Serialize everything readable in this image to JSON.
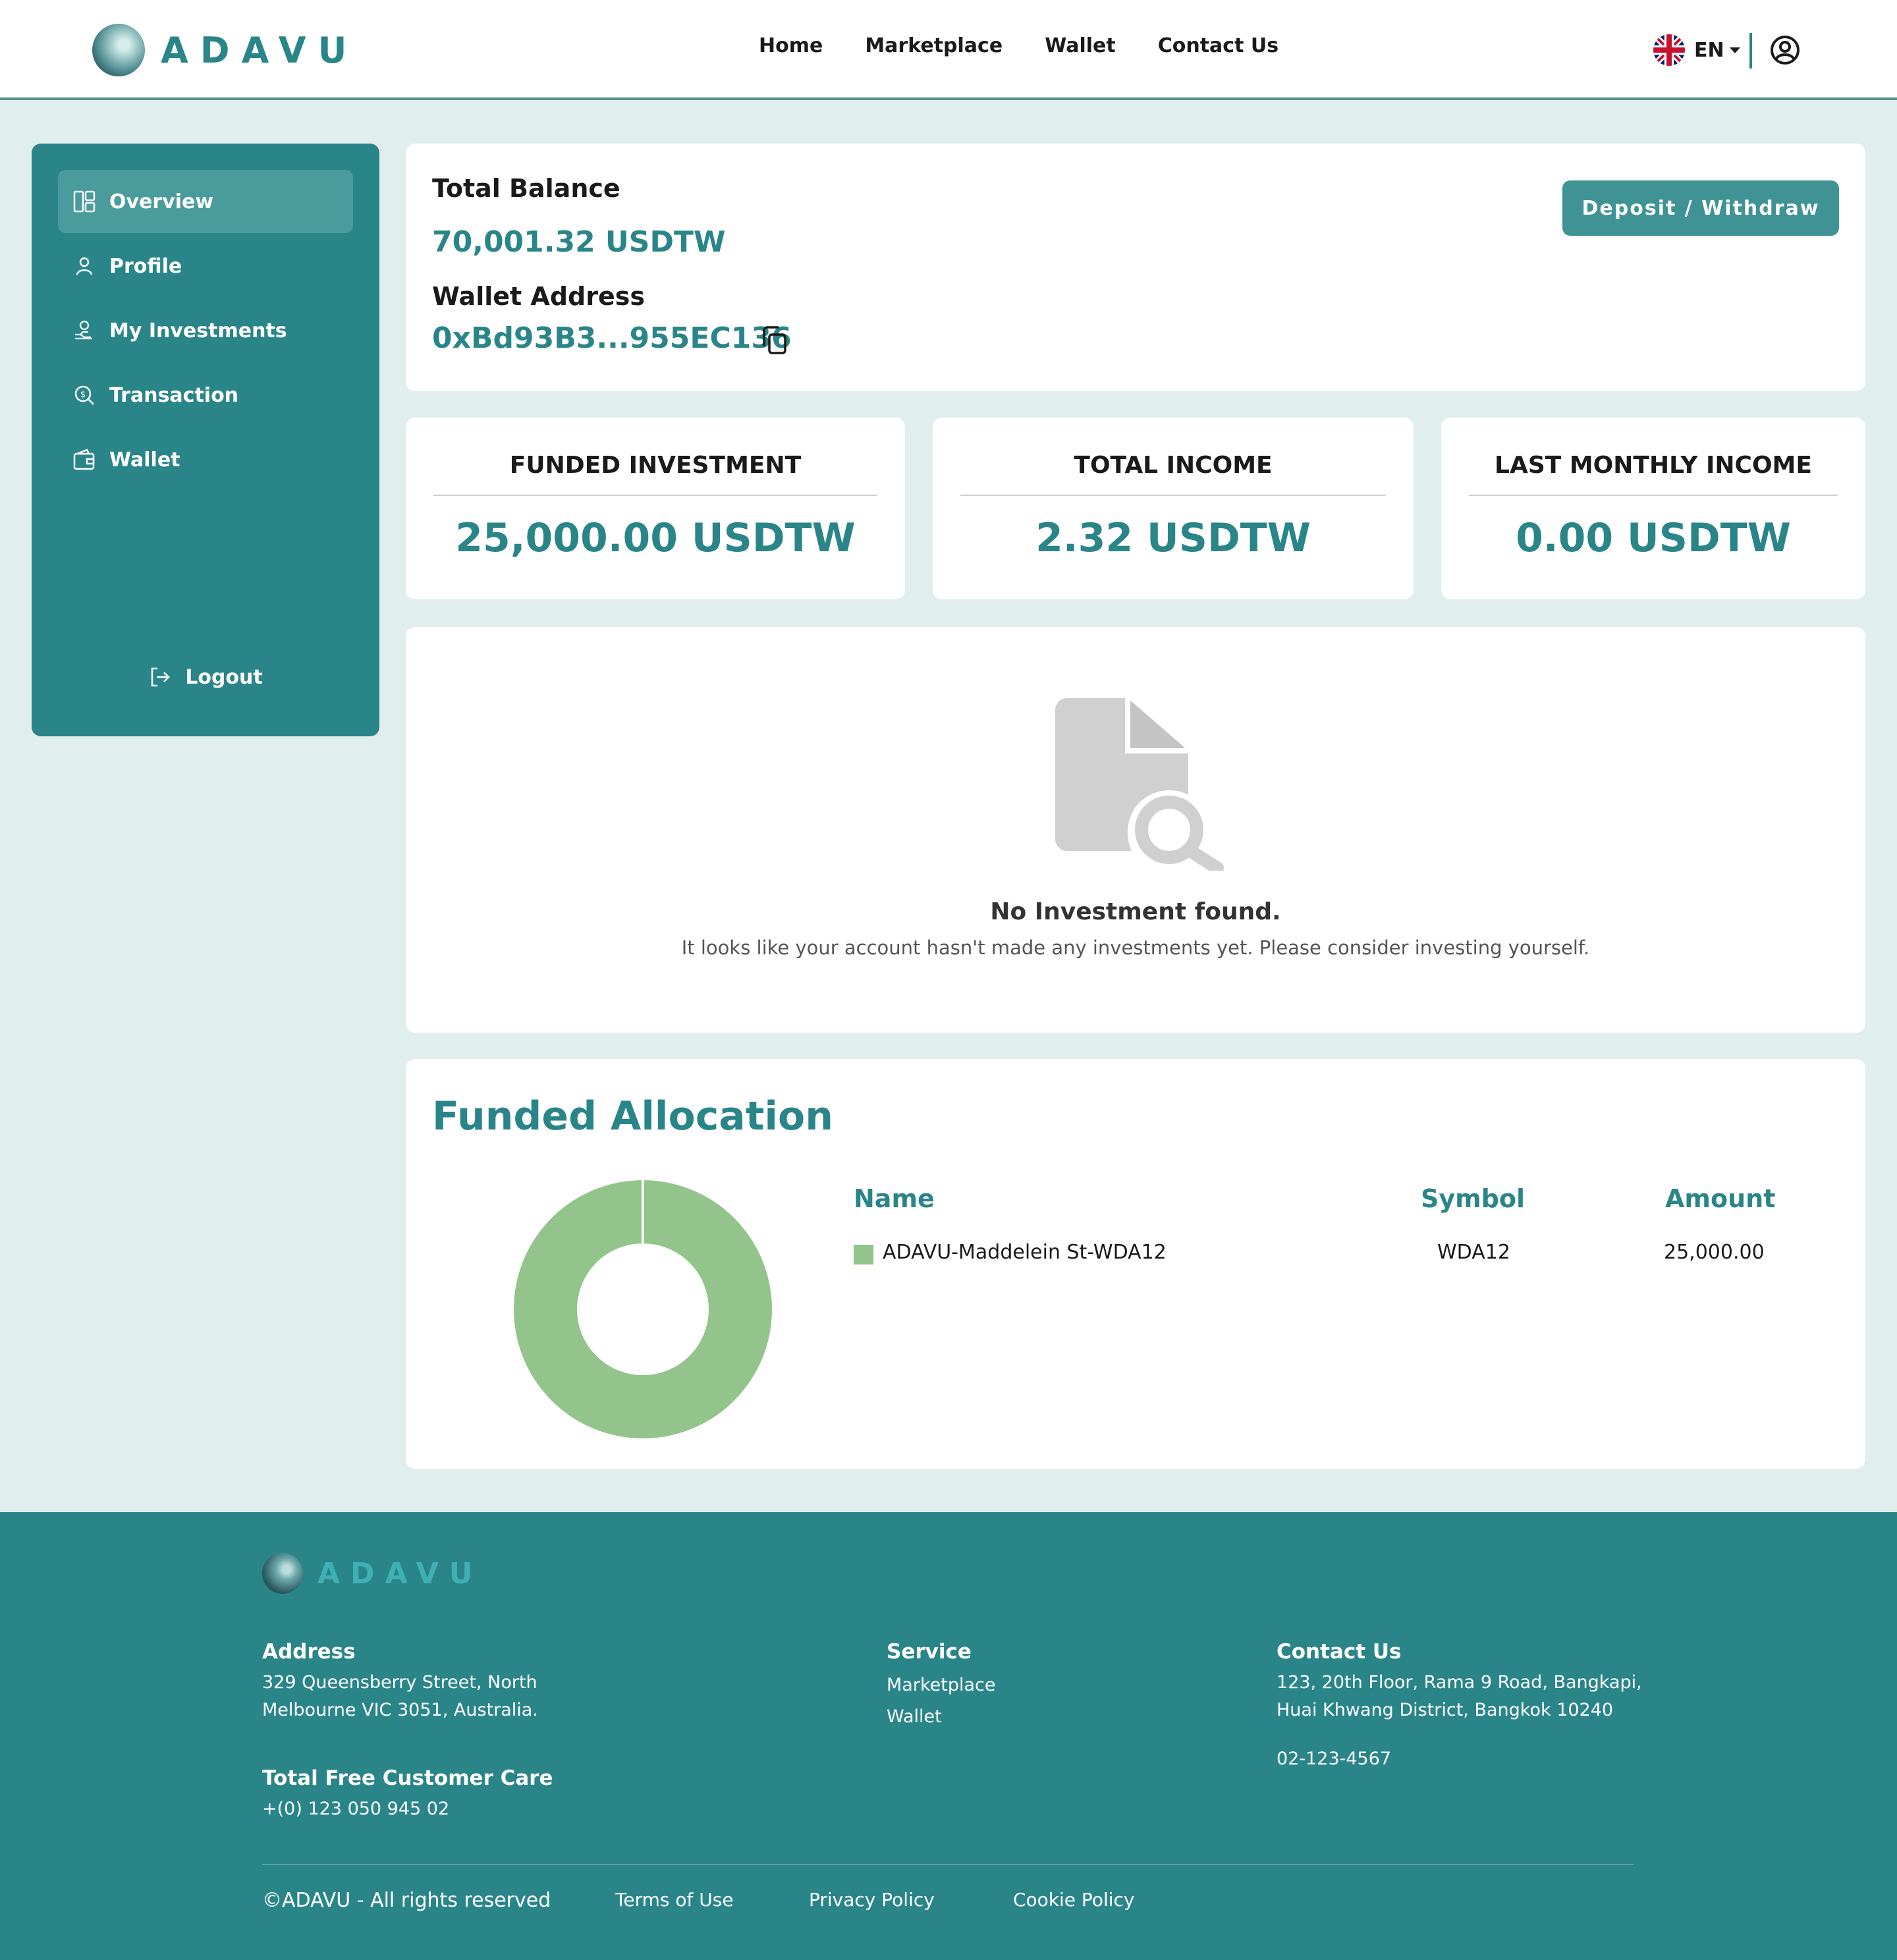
{
  "brand": {
    "name": "ADAVU"
  },
  "nav": {
    "items": [
      {
        "label": "Home"
      },
      {
        "label": "Marketplace"
      },
      {
        "label": "Wallet"
      },
      {
        "label": "Contact Us"
      }
    ],
    "language": "EN"
  },
  "sidebar": {
    "items": [
      {
        "label": "Overview",
        "icon": "layout-icon",
        "active": true
      },
      {
        "label": "Profile",
        "icon": "person-icon"
      },
      {
        "label": "My Investments",
        "icon": "investment-icon"
      },
      {
        "label": "Transaction",
        "icon": "transaction-icon"
      },
      {
        "label": "Wallet",
        "icon": "wallet-icon"
      }
    ],
    "logout_label": "Logout"
  },
  "balance": {
    "title": "Total Balance",
    "value": "70,001.32 USDTW",
    "wallet_title": "Wallet Address",
    "wallet_address": "0xBd93B3...955EC136",
    "button_label": "Deposit / Withdraw"
  },
  "stats": [
    {
      "title": "FUNDED INVESTMENT",
      "value": "25,000.00 USDTW"
    },
    {
      "title": "TOTAL INCOME",
      "value": "2.32 USDTW"
    },
    {
      "title": "LAST MONTHLY INCOME",
      "value": "0.00 USDTW"
    }
  ],
  "empty_state": {
    "title": "No Investment found.",
    "text": "It looks like your account hasn't made any investments yet. Please consider investing yourself."
  },
  "allocation": {
    "title": "Funded Allocation",
    "headers": {
      "name": "Name",
      "symbol": "Symbol",
      "amount": "Amount"
    },
    "rows": [
      {
        "name": "ADAVU-Maddelein St-WDA12",
        "symbol": "WDA12",
        "amount": "25,000.00",
        "color": "#93c48b"
      }
    ]
  },
  "chart_data": {
    "type": "pie",
    "categories": [
      "ADAVU-Maddelein St-WDA12"
    ],
    "values": [
      25000.0
    ],
    "colors": [
      "#93c48b"
    ]
  },
  "footer": {
    "address_title": "Address",
    "address_line1": "329 Queensberry Street, North",
    "address_line2": "Melbourne VIC 3051, Australia.",
    "care_title": "Total Free Customer Care",
    "care_phone": "+(0) 123 050 945 02",
    "service_title": "Service",
    "service_links": [
      "Marketplace",
      "Wallet"
    ],
    "contact_title": "Contact Us",
    "contact_line1": "123, 20th Floor, Rama 9 Road, Bangkapi,",
    "contact_line2": "Huai Khwang District, Bangkok 10240",
    "contact_phone": "02-123-4567",
    "copyright": "©ADAVU - All rights reserved",
    "terms": "Terms of Use",
    "privacy": "Privacy Policy",
    "cookie": "Cookie Policy"
  },
  "colors": {
    "primary": "#2a8589",
    "page_bg": "#e1eeee",
    "accent_button": "#3f9394",
    "allocation_series": "#93c48b"
  }
}
